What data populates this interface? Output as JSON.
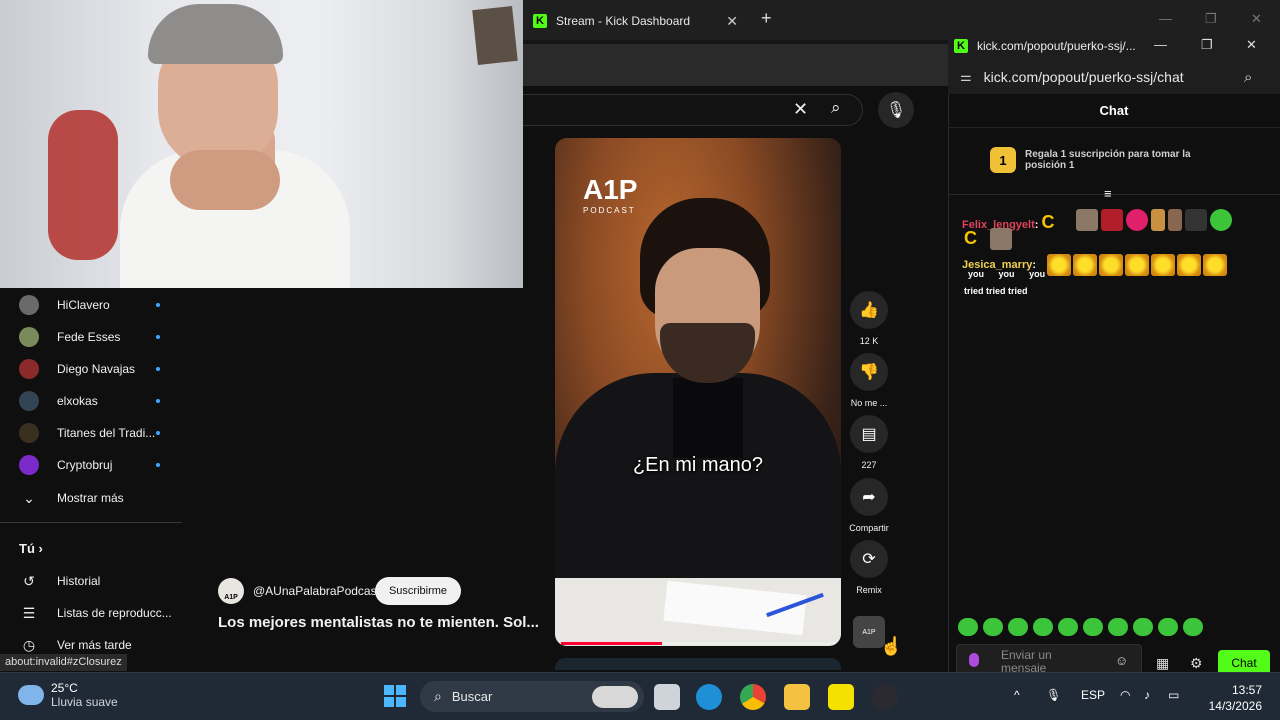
{
  "browser": {
    "tab_title": "Stream - Kick Dashboard",
    "tab_close": "✕",
    "new_tab": "+",
    "window_controls": [
      "—",
      "❐",
      "✕"
    ]
  },
  "youtube": {
    "search_clear": "✕",
    "search_icon": "⌕",
    "mic_icon": "🎙",
    "subscriptions": [
      {
        "name": "HiClavero",
        "color": "#6a6a6a"
      },
      {
        "name": "Fede Esses",
        "color": "#7b8a5a"
      },
      {
        "name": "Diego Navajas",
        "color": "#8a2a2a"
      },
      {
        "name": "elxokas",
        "color": "#334455"
      },
      {
        "name": "Titanes del Tradi...",
        "color": "#3a3020"
      },
      {
        "name": "Cryptobruj",
        "color": "#7a2ac8"
      }
    ],
    "show_more": "Mostrar más",
    "you_label": "Tú",
    "you_links": [
      {
        "label": "Historial",
        "icon": "history-icon"
      },
      {
        "label": "Listas de reproducc...",
        "icon": "playlist-icon"
      },
      {
        "label": "Ver más tarde",
        "icon": "clock-icon"
      }
    ],
    "video": {
      "logo": "A1P",
      "logo_sub": "PODCAST",
      "subtitle": "¿En mi mano?",
      "progress": 0.37
    },
    "channel": {
      "avatar_text": "A1P",
      "handle": "@AUnaPalabraPodcast",
      "subscribe": "Suscribirme",
      "title": "Los mejores mentalistas no te mienten. Sol..."
    },
    "actions": [
      {
        "label": "12 K",
        "icon": "like-icon",
        "glyph": "👍"
      },
      {
        "label": "No me ...",
        "icon": "dislike-icon",
        "glyph": "👎"
      },
      {
        "label": "227",
        "icon": "comment-icon",
        "glyph": "▤"
      },
      {
        "label": "Compartir",
        "icon": "share-icon",
        "glyph": "➦"
      },
      {
        "label": "Remix",
        "icon": "remix-icon",
        "glyph": "⟳"
      }
    ],
    "action_avatar": "A1P"
  },
  "status_link": "about:invalid#zClosurez",
  "chat": {
    "window_title": "kick.com/popout/puerko-ssj/...",
    "url": "kick.com/popout/puerko-ssj/chat",
    "header": "Chat",
    "gift_rank": "1",
    "gift_text": "Regala 1 suscripción para tomar la posición 1",
    "pin_icon": "≡",
    "messages": [
      {
        "user": "Felix_lengyelt",
        "color": "#e0445a",
        "text": "C"
      },
      {
        "user": "Jesica_marry",
        "color": "#f0d050",
        "text": ""
      }
    ],
    "msg2_extra_c": "C",
    "you_words": [
      "you",
      "you",
      "you"
    ],
    "tried_words": "tried tried tried",
    "input_placeholder": "Enviar un mensaje",
    "send_label": "Chat",
    "smile": "☺",
    "store_icon": "▦",
    "gear_icon": "⚙"
  },
  "taskbar": {
    "temperature": "25°C",
    "weather": "Lluvia suave",
    "search": "Buscar",
    "language": "ESP",
    "time": "13:57",
    "date": "14/3/2026",
    "up_arrow": "^"
  }
}
